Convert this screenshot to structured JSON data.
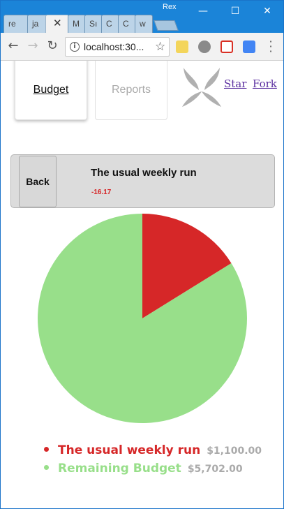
{
  "browser": {
    "profile_name": "Rex",
    "tabs": [
      {
        "label": "re"
      },
      {
        "label": "ja"
      },
      {
        "label": "",
        "close": "✕"
      },
      {
        "label": "M"
      },
      {
        "label": "Sı"
      },
      {
        "label": "C"
      },
      {
        "label": "C"
      },
      {
        "label": "w"
      }
    ],
    "url": "localhost:30...",
    "window_controls": {
      "minimize": "—",
      "maximize": "☐",
      "close": "✕"
    }
  },
  "nav": {
    "budget_label": "Budget",
    "reports_label": "Reports",
    "star_label": "Star",
    "fork_label": "Fork"
  },
  "header": {
    "back_label": "Back",
    "budget_name": "The usual weekly run",
    "budget_amount": "-16.17"
  },
  "colors": {
    "spent": "#d62728",
    "remaining": "#98df8a"
  },
  "chart_data": {
    "type": "pie",
    "categories": [
      "The usual weekly run",
      "Remaining Budget"
    ],
    "values": [
      1100.0,
      5702.0
    ],
    "value_labels": [
      "$1,100.00",
      "$5,702.00"
    ],
    "colors": [
      "#d62728",
      "#98df8a"
    ],
    "legend_position": "bottom"
  }
}
